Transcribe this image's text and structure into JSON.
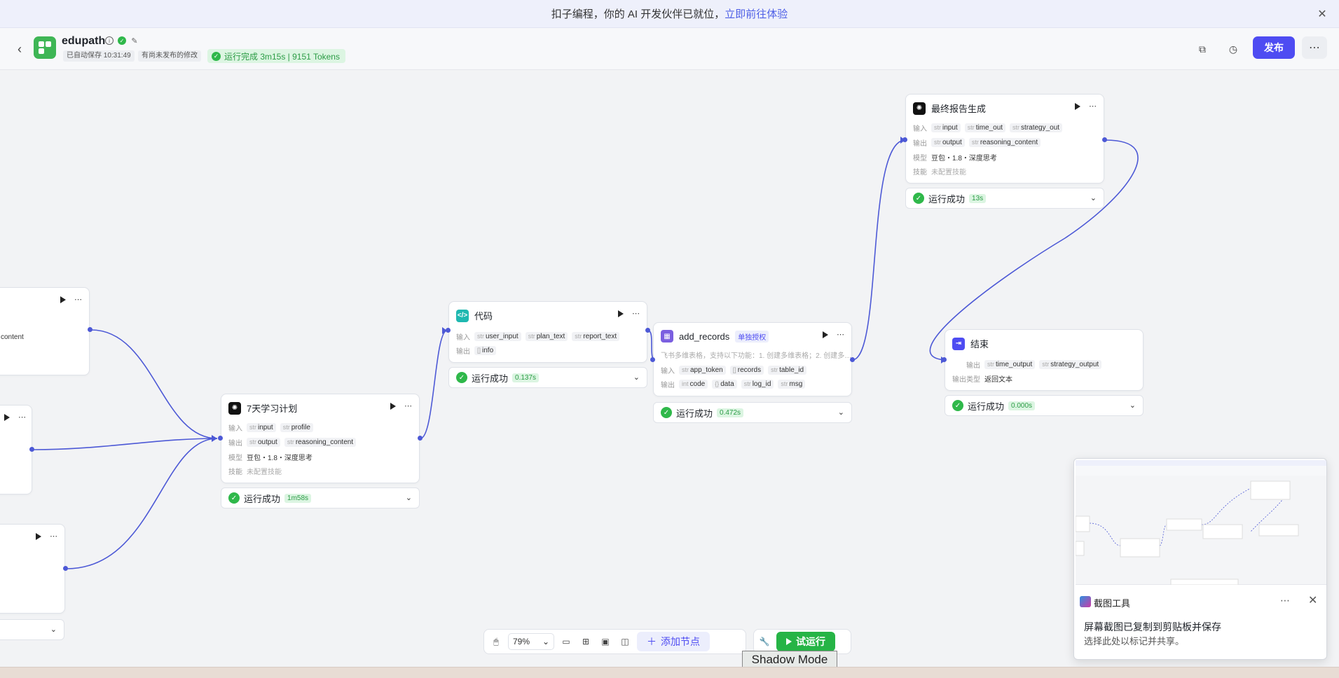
{
  "banner": {
    "text": "扣子编程，你的 AI 开发伙伴已就位，",
    "link": "立即前往体验"
  },
  "header": {
    "app_name": "edupath",
    "autosave": "已自动保存 10:31:49",
    "unpublished": "有尚未发布的修改",
    "run_status": "运行完成 3m15s | 9151 Tokens",
    "publish": "发布"
  },
  "labels": {
    "input": "输入",
    "output": "输出",
    "model": "模型",
    "skill": "技能",
    "output_type": "输出类型",
    "not_configured": "未配置技能",
    "success": "运行成功"
  },
  "nodes": {
    "left_top": {
      "chip": "content"
    },
    "left_bottom": {
      "chip": ""
    },
    "plan": {
      "title": "7天学习计划",
      "inputs": [
        "input",
        "profile"
      ],
      "outputs": [
        "output",
        "reasoning_content"
      ],
      "model": "豆包・1.8・深度思考",
      "time": "1m58s"
    },
    "code": {
      "title": "代码",
      "inputs": [
        "user_input",
        "plan_text",
        "report_text"
      ],
      "outputs": [
        "info"
      ],
      "time": "0.137s"
    },
    "records": {
      "title": "add_records",
      "badge": "单独授权",
      "desc": "飞书多维表格，支持以下功能：1. 创建多维表格；2. 创建多…",
      "inputs": [
        "app_token",
        "records",
        "table_id"
      ],
      "outputs": [
        "code",
        "data",
        "log_id",
        "msg"
      ],
      "time": "0.472s"
    },
    "report": {
      "title": "最终报告生成",
      "inputs": [
        "input",
        "time_out",
        "strategy_out"
      ],
      "outputs": [
        "output",
        "reasoning_content"
      ],
      "model": "豆包・1.8・深度思考",
      "time": "13s"
    },
    "end": {
      "title": "结束",
      "outputs": [
        "time_output",
        "strategy_output"
      ],
      "output_type": "返回文本",
      "time": "0.000s"
    }
  },
  "toolbar": {
    "zoom": "79%",
    "add_node": "添加节点",
    "try_run": "试运行",
    "shadow_mode": "Shadow Mode"
  },
  "snip": {
    "title": "截图工具",
    "message": "屏幕截图已复制到剪贴板并保存",
    "sub": "选择此处以标记并共享。"
  },
  "colors": {
    "accent": "#4e4cf2",
    "success": "#2fb84a",
    "wire": "#4d59d6"
  }
}
